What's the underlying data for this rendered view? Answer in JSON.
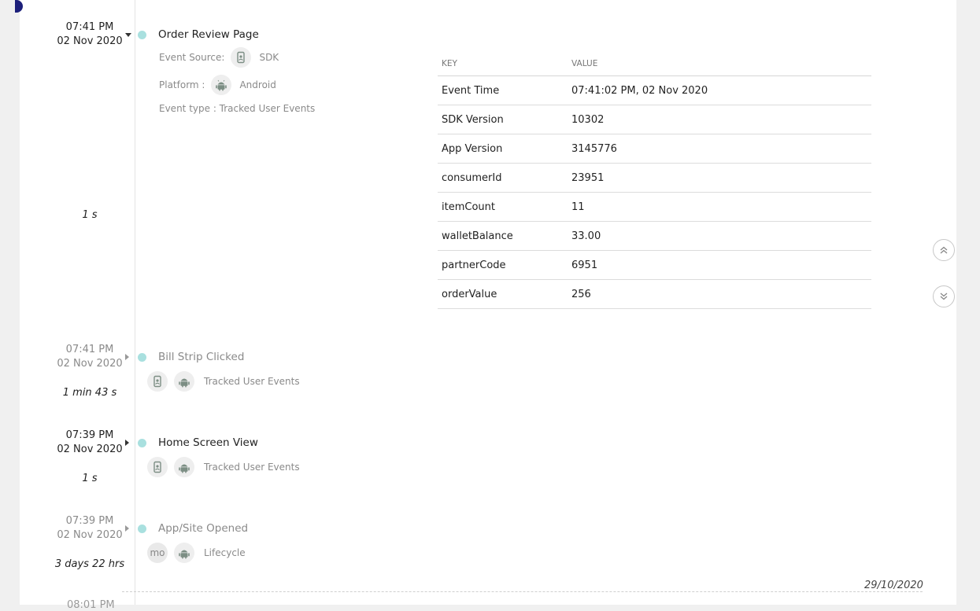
{
  "events": [
    {
      "time": "07:41 PM",
      "date": "02 Nov 2020",
      "name": "Order Review Page",
      "duration": "1 s",
      "expanded": true,
      "source_label": "Event Source:",
      "source_value": "SDK",
      "platform_label": "Platform :",
      "platform_value": "Android",
      "event_type": "Event type : Tracked User Events",
      "table": {
        "key_header": "KEY",
        "value_header": "VALUE",
        "rows": [
          {
            "key": "Event Time",
            "value": "07:41:02 PM, 02 Nov 2020"
          },
          {
            "key": "SDK Version",
            "value": "10302"
          },
          {
            "key": "App Version",
            "value": "3145776"
          },
          {
            "key": "consumerId",
            "value": "23951"
          },
          {
            "key": "itemCount",
            "value": "11"
          },
          {
            "key": "walletBalance",
            "value": "33.00"
          },
          {
            "key": "partnerCode",
            "value": "6951"
          },
          {
            "key": "orderValue",
            "value": "256"
          }
        ]
      }
    },
    {
      "time": "07:41 PM",
      "date": "02 Nov 2020",
      "name": "Bill Strip Clicked",
      "duration": "1 min 43 s",
      "category": "Tracked User Events"
    },
    {
      "time": "07:39 PM",
      "date": "02 Nov 2020",
      "name": "Home Screen View",
      "duration": "1 s",
      "category": "Tracked User Events"
    },
    {
      "time": "07:39 PM",
      "date": "02 Nov 2020",
      "name": "App/Site Opened",
      "duration": "3 days 22 hrs",
      "badge": "mo",
      "category": "Lifecycle"
    }
  ],
  "date_divider": "29/10/2020",
  "cut_off_time": "08:01 PM",
  "icons": {
    "sdk": "mobile-sdk-icon",
    "platform": "android-icon",
    "scroll_up": "double-chevron-up-icon",
    "scroll_down": "double-chevron-down-icon"
  },
  "colors": {
    "event_dot": "#a9e0df",
    "icon": "#7c8e84"
  }
}
